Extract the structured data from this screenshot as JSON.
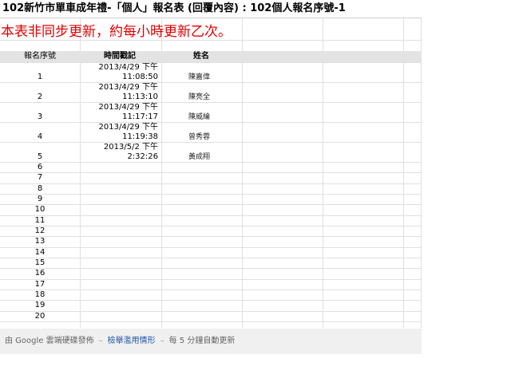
{
  "sheet": {
    "title": "102新竹市單車成年禮-「個人」報名表 (回覆內容) : 102個人報名序號-1",
    "notice": "本表非同步更新，約每小時更新乙次。",
    "headers": {
      "col_a": "報名序號",
      "col_b": "時間戳記",
      "col_c": "姓名"
    },
    "rows": [
      {
        "num": "1",
        "date": "2013/4/29 下午",
        "time": "11:08:50",
        "name": "陳嘉偉"
      },
      {
        "num": "2",
        "date": "2013/4/29 下午",
        "time": "11:13:10",
        "name": "陳亮全"
      },
      {
        "num": "3",
        "date": "2013/4/29 下午",
        "time": "11:17:17",
        "name": "陳威綸"
      },
      {
        "num": "4",
        "date": "2013/4/29 下午",
        "time": "11:19:38",
        "name": "曾秀蓉"
      },
      {
        "num": "5",
        "date": "2013/5/2 下午",
        "time": "2:32:26",
        "name": "黃成翔"
      }
    ],
    "empty_rows": [
      "6",
      "7",
      "8",
      "9",
      "10",
      "11",
      "12",
      "13",
      "14",
      "15",
      "16",
      "17",
      "18",
      "19",
      "20"
    ]
  },
  "footer": {
    "published_by": "由 Google 雲端硬碟發佈",
    "report_abuse": "檢舉濫用情形",
    "auto_update": "每 5 分鐘自動更新",
    "separator": "–"
  }
}
